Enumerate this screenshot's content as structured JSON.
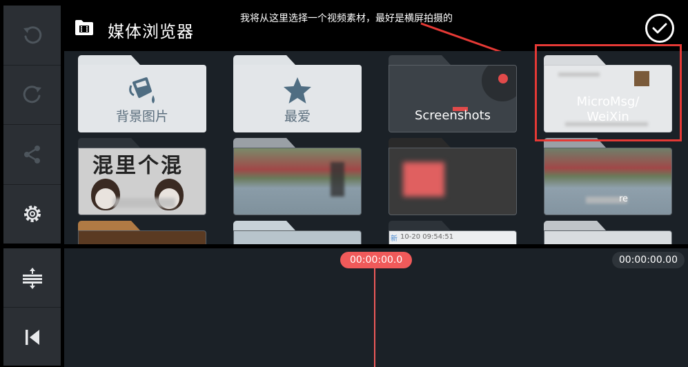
{
  "header": {
    "title": "媒体浏览器",
    "annotation": "我将从这里选择一个视频素材，最好是横屏拍摄的"
  },
  "sidebar": {
    "items": [
      {
        "icon": "undo-icon"
      },
      {
        "icon": "redo-icon"
      },
      {
        "icon": "share-icon"
      },
      {
        "icon": "gear-icon"
      }
    ],
    "bottom": [
      {
        "icon": "split-layers-icon"
      },
      {
        "icon": "skip-to-start-icon"
      }
    ]
  },
  "folders": [
    {
      "label": "背景图片",
      "icon": "paint-bucket-icon"
    },
    {
      "label": "最爱",
      "icon": "star-icon"
    },
    {
      "label": "Screenshots"
    },
    {
      "label_line1": "MicroMsg/",
      "label_line2": "WeiXin"
    }
  ],
  "thumbs": {
    "meme_text": "混里个混",
    "timestamp": "10-20 09:54:51",
    "partial_text": "新",
    "suffix_text": "re"
  },
  "timeline": {
    "current_time": "00:00:00.0",
    "total_time": "00:00:00.00"
  },
  "colors": {
    "accent": "#f05a5a",
    "highlight_box": "#e53935",
    "panel": "#2b2f34",
    "grid_bg": "#1b2127"
  }
}
